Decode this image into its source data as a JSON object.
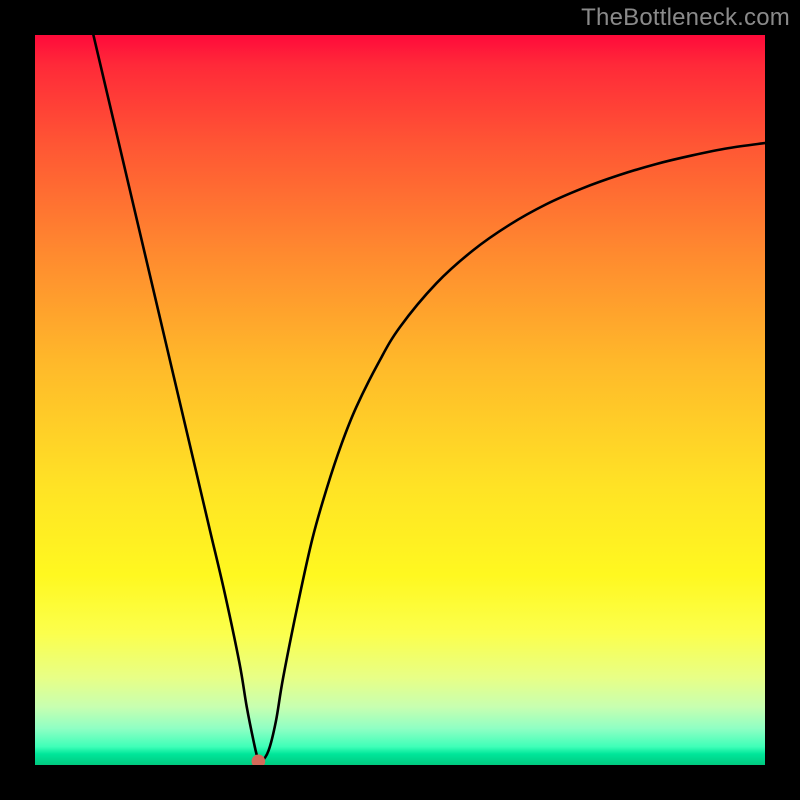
{
  "watermark": "TheBottleneck.com",
  "chart_data": {
    "type": "line",
    "title": "",
    "xlabel": "",
    "ylabel": "",
    "xlim": [
      0,
      100
    ],
    "ylim": [
      0,
      100
    ],
    "grid": false,
    "legend": false,
    "series": [
      {
        "name": "curve",
        "x": [
          8,
          10,
          12,
          14,
          16,
          18,
          20,
          22,
          24,
          26,
          28,
          29,
          30,
          30.5,
          31,
          32,
          33,
          34,
          36,
          38,
          40,
          42,
          44,
          47,
          50,
          55,
          60,
          65,
          70,
          75,
          80,
          85,
          90,
          95,
          100
        ],
        "y": [
          100,
          91.5,
          83,
          74.5,
          66,
          57.5,
          49,
          40.5,
          32,
          23.5,
          14,
          8,
          3,
          1,
          0.5,
          2,
          6,
          12,
          22,
          31,
          38,
          44,
          49,
          55,
          60,
          66,
          70.5,
          74,
          76.8,
          79,
          80.8,
          82.3,
          83.5,
          84.5,
          85.2
        ]
      }
    ],
    "marker": {
      "x": 30.6,
      "y": 0.5,
      "color": "#d46a5a"
    },
    "background_gradient": {
      "top": "#ff0a3a",
      "mid": "#ffe325",
      "bottom": "#00c97f"
    }
  }
}
